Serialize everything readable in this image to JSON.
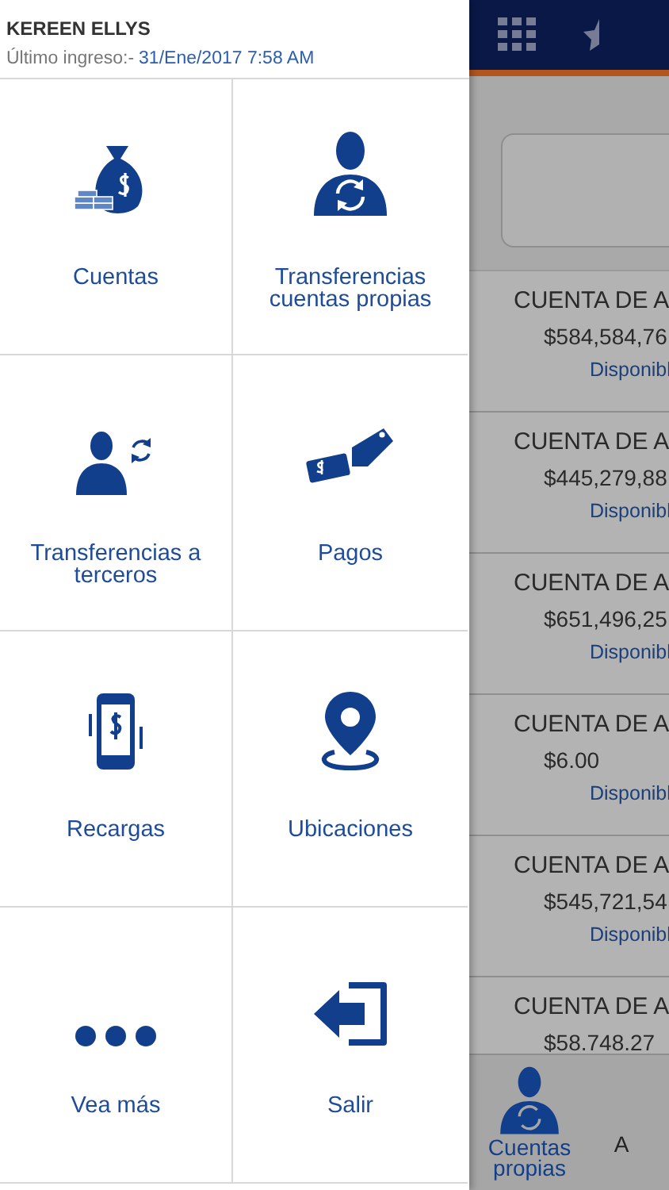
{
  "drawer": {
    "user_name": "KEREEN ELLYS",
    "last_login_label": "Último ingreso:-",
    "last_login_value": "31/Ene/2017 7:58 AM",
    "menu": [
      {
        "label": "Cuentas",
        "kind": "money-bag"
      },
      {
        "label": "Transferencias cuentas propias",
        "kind": "person-sync"
      },
      {
        "label": "Transferencias a terceros",
        "kind": "person-transfer"
      },
      {
        "label": "Pagos",
        "kind": "payment"
      },
      {
        "label": "Recargas",
        "kind": "phone-dollar"
      },
      {
        "label": "Ubicaciones",
        "kind": "location"
      },
      {
        "label": "Vea más",
        "kind": "more"
      },
      {
        "label": "Salir",
        "kind": "logout"
      }
    ]
  },
  "accounts": [
    {
      "name": "CUENTA DE A",
      "balance": "$584,584,76",
      "status": "Disponibl"
    },
    {
      "name": "CUENTA DE A",
      "balance": "$445,279,88",
      "status": "Disponibl"
    },
    {
      "name": "CUENTA DE A",
      "balance": "$651,496,25",
      "status": "Disponibl"
    },
    {
      "name": "CUENTA DE A",
      "balance": "$6.00",
      "status": "Disponibl"
    },
    {
      "name": "CUENTA DE A",
      "balance": "$545,721,54",
      "status": "Disponibl"
    },
    {
      "name": "CUENTA DE A",
      "balance": "$58.748.27"
    }
  ],
  "tab_bar": [
    {
      "label": "Cuentas propias",
      "selected": true
    },
    {
      "label": "A",
      "selected": false
    }
  ]
}
